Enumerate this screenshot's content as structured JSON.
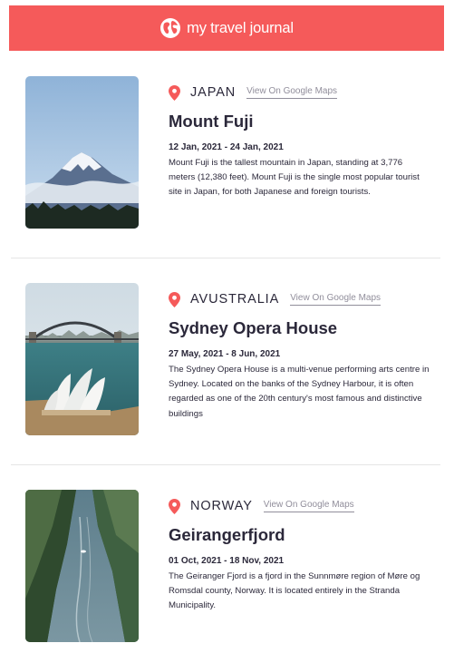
{
  "header": {
    "title": "my travel journal",
    "icon": "globe-icon",
    "background": "#f55a5a"
  },
  "entries": [
    {
      "country": "JAPAN",
      "maps_link": "View On Google Maps",
      "title": "Mount Fuji",
      "dates": "12 Jan, 2021 - 24 Jan, 2021",
      "description": "Mount Fuji is the tallest mountain in Japan, standing at 3,776 meters (12,380 feet). Mount Fuji is the single most popular tourist site in Japan, for both Japanese and foreign tourists.",
      "image": "mount-fuji-photo"
    },
    {
      "country": "AVUSTRALIA",
      "maps_link": "View On Google Maps",
      "title": "Sydney Opera House",
      "dates": "27 May, 2021 - 8 Jun, 2021",
      "description": "The Sydney Opera House is a multi-venue performing arts centre in Sydney. Located on the banks of the Sydney Harbour, it is often regarded as one of the 20th century's most famous and distinctive buildings",
      "image": "sydney-opera-house-photo"
    },
    {
      "country": "NORWAY",
      "maps_link": "View On Google Maps",
      "title": "Geirangerfjord",
      "dates": "01 Oct, 2021 - 18 Nov, 2021",
      "description": "The Geiranger Fjord is a fjord in the Sunnmøre region of Møre og Romsdal county, Norway. It is located entirely in the Stranda Municipality.",
      "image": "geirangerfjord-photo"
    }
  ],
  "colors": {
    "accent": "#f55a5a",
    "text": "#2b283a",
    "muted": "#918e9b"
  }
}
